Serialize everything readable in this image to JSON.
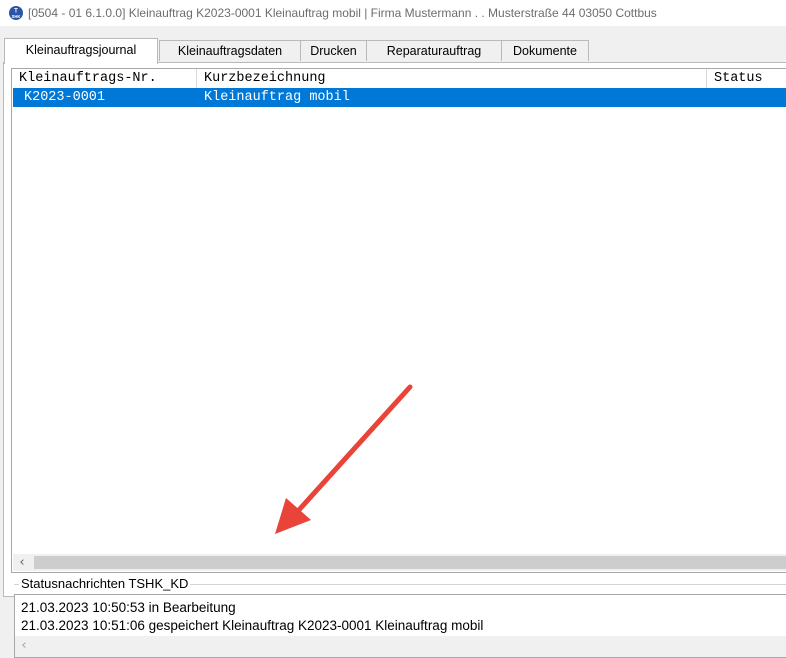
{
  "window": {
    "title": "[0504 - 01  6.1.0.0] Kleinauftrag K2023-0001 Kleinauftrag mobil |  Firma Mustermann . . Musterstraße 44 03050 Cottbus",
    "icon": "tshk-app-icon",
    "icon_text_top": "T",
    "icon_text_bottom": "SHK"
  },
  "tabs": [
    {
      "label": "Kleinauftragsjournal",
      "active": true
    },
    {
      "label": "Kleinauftragsdaten",
      "active": false
    },
    {
      "label": "Drucken",
      "active": false
    },
    {
      "label": "Reparaturauftrag",
      "active": false
    },
    {
      "label": "Dokumente",
      "active": false
    }
  ],
  "journal": {
    "columns": [
      "Kleinauftrags-Nr.",
      "Kurzbezeichnung",
      "Status"
    ],
    "rows": [
      {
        "nr": "K2023-0001",
        "bezeichnung": "Kleinauftrag mobil",
        "status": "",
        "selected": true
      }
    ],
    "scroll_left_icon": "chevron-left-icon"
  },
  "status_messages": {
    "title": "Statusnachrichten TSHK_KD",
    "lines": [
      "21.03.2023 10:50:53 in Bearbeitung",
      "21.03.2023 10:51:06 gespeichert  Kleinauftrag K2023-0001 Kleinauftrag mobil"
    ],
    "scroll_left_icon": "chevron-left-icon"
  },
  "annotation": {
    "type": "arrow",
    "color": "#e8443a"
  },
  "colors": {
    "selection": "#0078d7",
    "selection_text": "#ffffff",
    "title_text": "#6d6d6d"
  }
}
